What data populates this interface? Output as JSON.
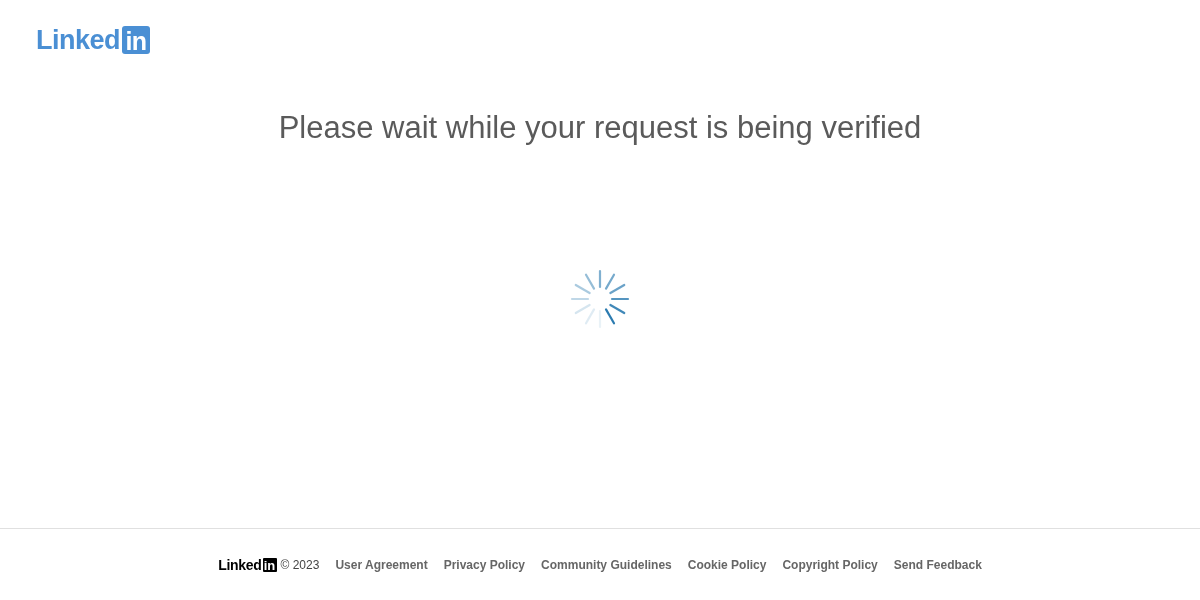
{
  "header": {
    "logo": {
      "word": "Linked",
      "badge": "in"
    }
  },
  "heading": "Please wait while your request is being verified",
  "footer": {
    "logo": {
      "word": "Linked",
      "badge": "in"
    },
    "copyright": "© 2023",
    "links": [
      "User Agreement",
      "Privacy Policy",
      "Community Guidelines",
      "Cookie Policy",
      "Copyright Policy",
      "Send Feedback"
    ]
  }
}
